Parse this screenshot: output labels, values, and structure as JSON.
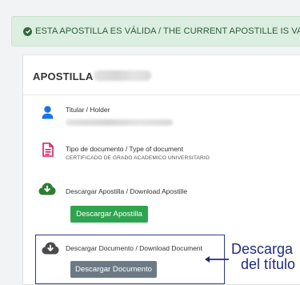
{
  "alert": {
    "text": "ESTA APOSTILLA ES VÁLIDA / THE CURRENT APOSTILLE IS VALID"
  },
  "card": {
    "title": "APOSTILLA",
    "holder": {
      "label": "Titular / Holder"
    },
    "document_type": {
      "label": "Tipo de documento / Type of document",
      "value": "CERTIFICADO DE GRADO ACADEMICO UNIVERSITARIO"
    },
    "download_apostille": {
      "label": "Descargar Apostilla / Download Apostille",
      "button": "Descargar Apostilla"
    },
    "download_document": {
      "label": "Descargar Documento / Download Document",
      "button": "Descargar Documento"
    }
  },
  "annotation": {
    "line1": "Descarga",
    "line2": "del título"
  },
  "colors": {
    "success_bg": "#dceee0",
    "success_text": "#2c5f3a",
    "holder_icon": "#1a73e8",
    "document_icon": "#d81b60",
    "download_icon_green": "#2e7d32",
    "download_icon_dark": "#4a4a4a",
    "button_green": "#2ea44f",
    "button_gray": "#6c7a86",
    "annotation": "#1f2b7a"
  },
  "icons": [
    "check-circle-icon",
    "user-icon",
    "document-icon",
    "cloud-download-icon",
    "arrow-left-icon"
  ]
}
